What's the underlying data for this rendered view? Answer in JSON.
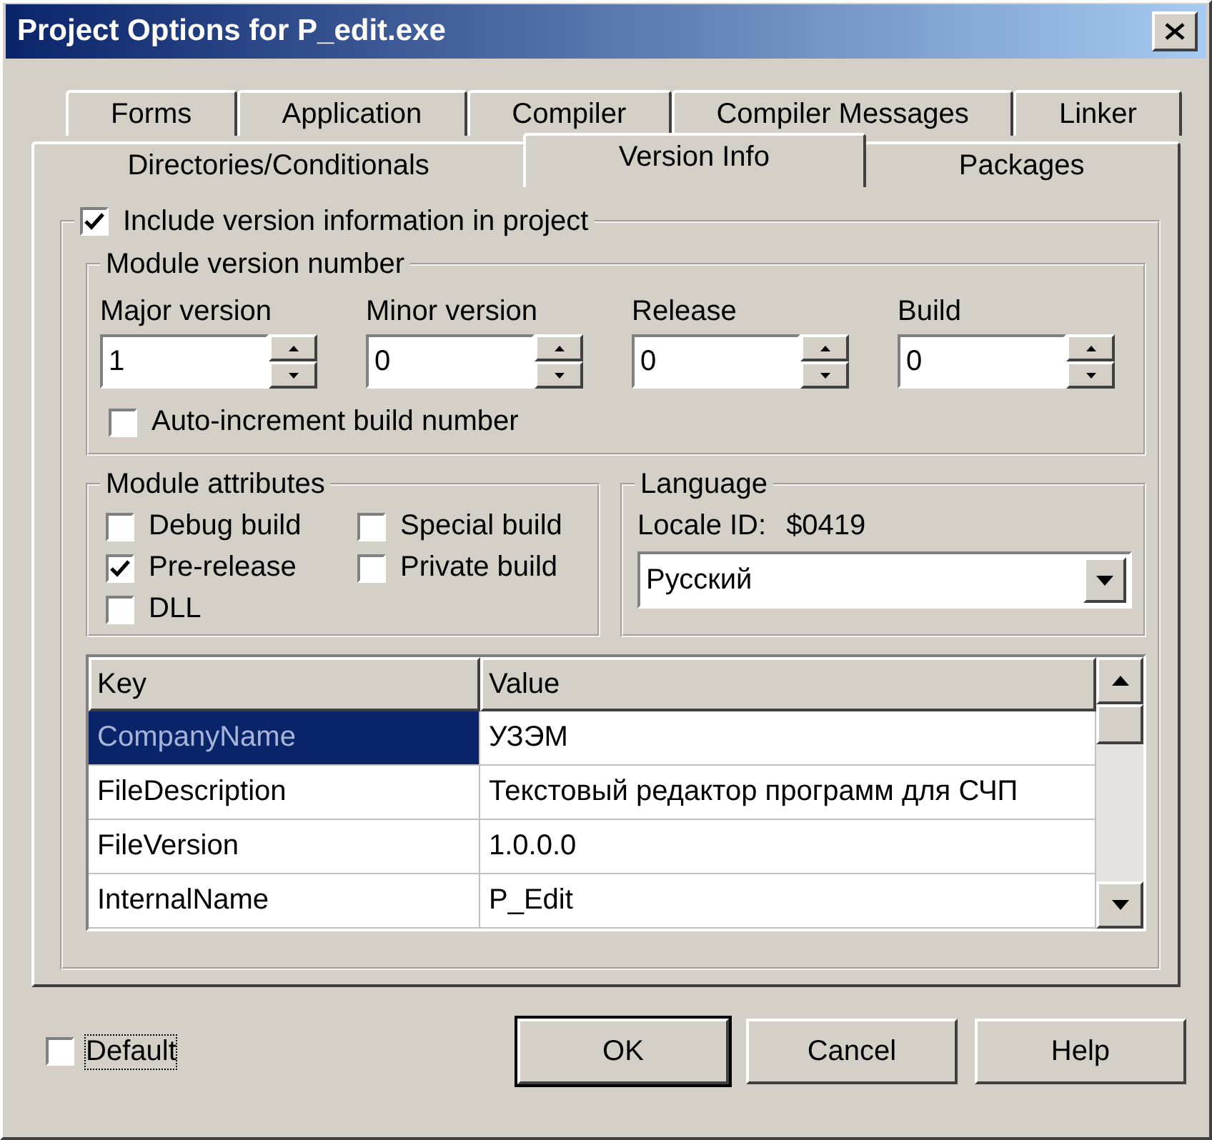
{
  "window": {
    "title": "Project Options for P_edit.exe"
  },
  "tab_rows": [
    {
      "tabs": [
        {
          "label": "Forms",
          "selected": false
        },
        {
          "label": "Application",
          "selected": false
        },
        {
          "label": "Compiler",
          "selected": false
        },
        {
          "label": "Compiler Messages",
          "selected": false
        },
        {
          "label": "Linker",
          "selected": false
        }
      ]
    },
    {
      "tabs": [
        {
          "label": "Directories/Conditionals",
          "selected": false
        },
        {
          "label": "Version Info",
          "selected": true
        },
        {
          "label": "Packages",
          "selected": false
        }
      ]
    }
  ],
  "include_version_info": {
    "label": "Include version information in project",
    "checked": true
  },
  "module_version": {
    "title": "Module version number",
    "fields": [
      {
        "label": "Major version",
        "value": "1"
      },
      {
        "label": "Minor version",
        "value": "0"
      },
      {
        "label": "Release",
        "value": "0"
      },
      {
        "label": "Build",
        "value": "0"
      }
    ],
    "auto_increment": {
      "label": "Auto-increment build number",
      "checked": false
    }
  },
  "module_attributes": {
    "title": "Module attributes",
    "options": [
      {
        "label": "Debug build",
        "checked": false
      },
      {
        "label": "Special build",
        "checked": false
      },
      {
        "label": "Pre-release",
        "checked": true
      },
      {
        "label": "Private build",
        "checked": false
      },
      {
        "label": "DLL",
        "checked": false
      }
    ]
  },
  "language": {
    "title": "Language",
    "locale_label": "Locale ID:",
    "locale_value": "$0419",
    "dropdown": {
      "value": "Русский"
    }
  },
  "table": {
    "columns": [
      "Key",
      "Value"
    ],
    "rows": [
      {
        "key": "CompanyName",
        "value": "УЗЭМ",
        "selected": true
      },
      {
        "key": "FileDescription",
        "value": "Текстовый редактор программ для СЧП",
        "selected": false
      },
      {
        "key": "FileVersion",
        "value": "1.0.0.0",
        "selected": false
      },
      {
        "key": "InternalName",
        "value": "P_Edit",
        "selected": false
      }
    ]
  },
  "default": {
    "label": "Default",
    "checked": false,
    "focused": true
  },
  "buttons": [
    {
      "label": "OK",
      "default": true
    },
    {
      "label": "Cancel",
      "default": false
    },
    {
      "label": "Help",
      "default": false
    }
  ]
}
